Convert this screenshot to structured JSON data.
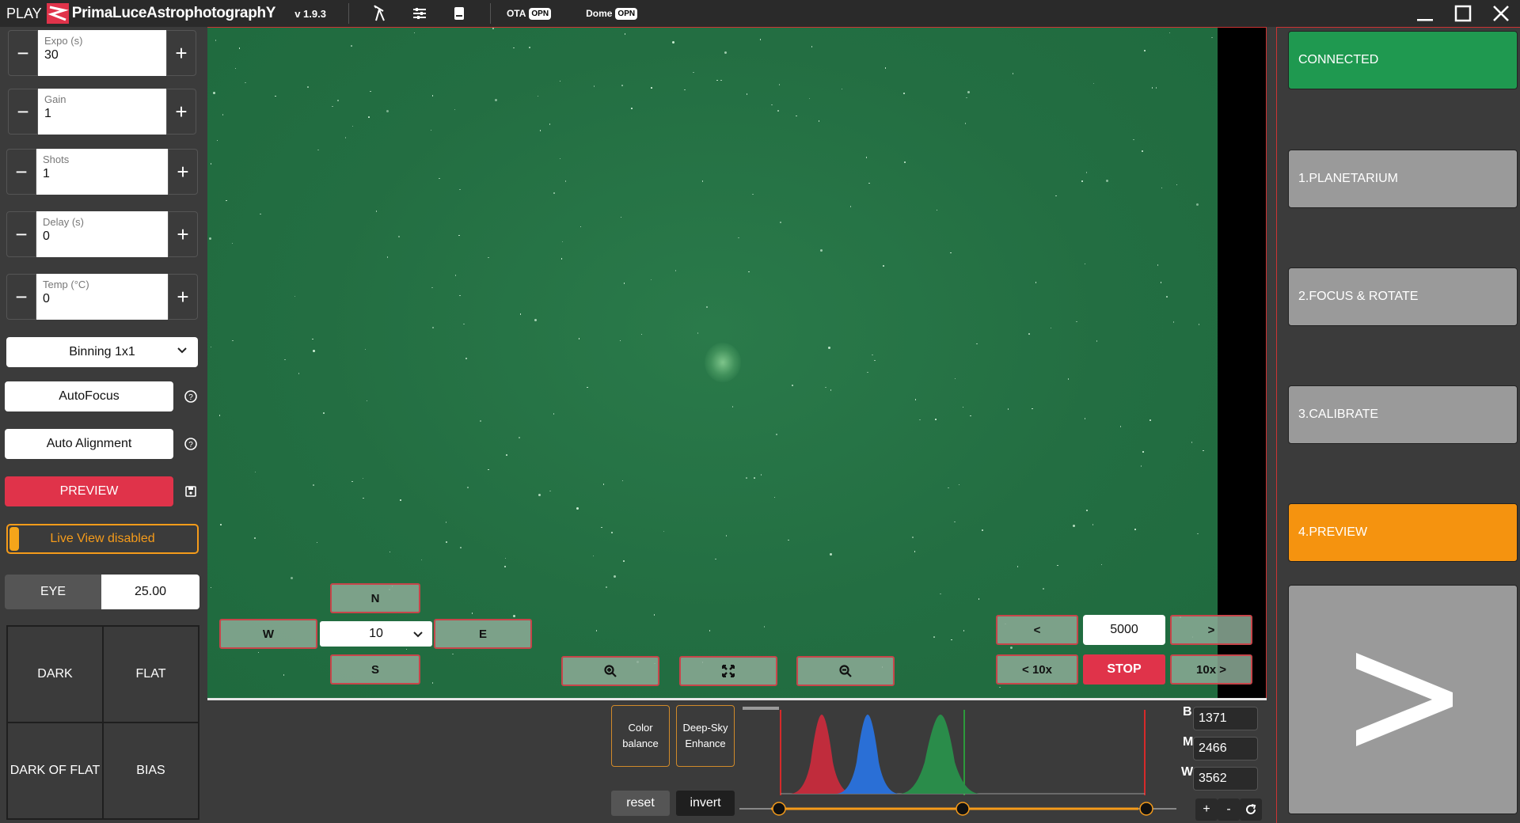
{
  "titlebar": {
    "play": "PLAY",
    "brand": "PrimaLuceAstrophotographY",
    "version": "v 1.9.3",
    "ota_label": "OTA",
    "ota_badge": "OPN",
    "dome_label": "Dome",
    "dome_badge": "OPN"
  },
  "left": {
    "expo": {
      "label": "Expo (s)",
      "value": "30"
    },
    "gain": {
      "label": "Gain",
      "value": "1"
    },
    "shots": {
      "label": "Shots",
      "value": "1"
    },
    "delay": {
      "label": "Delay (s)",
      "value": "0"
    },
    "temp": {
      "label": "Temp (°C)",
      "value": "0"
    },
    "binning": "Binning 1x1",
    "autofocus": "AutoFocus",
    "auto_alignment": "Auto Alignment",
    "preview": "PREVIEW",
    "live_view": "Live View disabled",
    "eye_label": "EYE",
    "eye_value": "25.00",
    "frames": [
      "DARK",
      "FLAT",
      "DARK OF FLAT",
      "BIAS"
    ]
  },
  "mount": {
    "north": "N",
    "south": "S",
    "west": "W",
    "east": "E",
    "rate": "10"
  },
  "seek": {
    "prev": "<",
    "next": ">",
    "prev10": "< 10x",
    "next10": "10x >",
    "value": "5000",
    "stop": "STOP"
  },
  "bottom": {
    "color_balance": "Color balance",
    "deep_sky": "Deep-Sky Enhance",
    "reset": "reset",
    "invert": "invert",
    "b_label": "B",
    "m_label": "M",
    "w_label": "W",
    "b_value": "1371",
    "m_value": "2466",
    "w_value": "3562",
    "plus": "+",
    "minus": "-"
  },
  "right": {
    "connected": "CONNECTED",
    "planetarium": "1.PLANETARIUM",
    "focus": "2.FOCUS & ROTATE",
    "calibrate": "3.CALIBRATE",
    "preview": "4.PREVIEW"
  },
  "colors": {
    "accent_red": "#e0334a",
    "accent_green": "#1f9950",
    "accent_orange": "#f5930f",
    "sky": "#236e42"
  }
}
